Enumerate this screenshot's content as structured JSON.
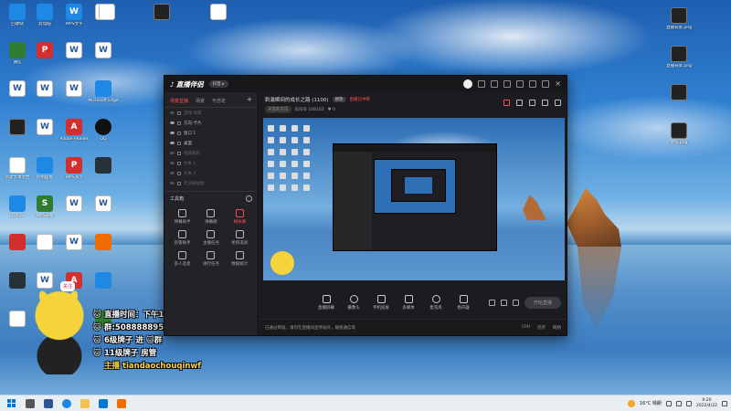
{
  "desktop": {
    "left_icons": [
      {
        "label": "回收站",
        "glyph": "",
        "cls": "g-blue"
      },
      {
        "label": "微信",
        "glyph": "",
        "cls": "g-green"
      },
      {
        "label": "",
        "glyph": "W",
        "cls": "g-doc"
      },
      {
        "label": "",
        "glyph": "",
        "cls": "g-img"
      },
      {
        "label": "新建文本文档",
        "glyph": "",
        "cls": "g-doc"
      },
      {
        "label": "10619",
        "glyph": "",
        "cls": "g-blue"
      },
      {
        "label": "",
        "glyph": "",
        "cls": "g-red"
      },
      {
        "label": "",
        "glyph": "",
        "cls": "g-dark"
      },
      {
        "label": "",
        "glyph": "",
        "cls": "g-doc"
      },
      {
        "label": "此电脑",
        "glyph": "",
        "cls": "g-blue"
      },
      {
        "label": "",
        "glyph": "P",
        "cls": "g-red"
      },
      {
        "label": "",
        "glyph": "W",
        "cls": "g-doc"
      },
      {
        "label": "",
        "glyph": "W",
        "cls": "g-doc"
      },
      {
        "label": "控制面板",
        "glyph": "",
        "cls": "g-blue"
      },
      {
        "label": "WPS表格",
        "glyph": "S",
        "cls": "g-green"
      },
      {
        "label": "",
        "glyph": "",
        "cls": "g-doc"
      },
      {
        "label": "",
        "glyph": "W",
        "cls": "g-doc"
      },
      {
        "label": "",
        "glyph": "",
        "cls": "g-dark"
      },
      {
        "label": "WPS文字",
        "glyph": "W",
        "cls": "g-blue"
      },
      {
        "label": "",
        "glyph": "W",
        "cls": "g-doc"
      },
      {
        "label": "",
        "glyph": "W",
        "cls": "g-doc"
      },
      {
        "label": "Adobe Reader",
        "glyph": "A",
        "cls": "g-red"
      },
      {
        "label": "WPS演示",
        "glyph": "P",
        "cls": "g-red"
      },
      {
        "label": "",
        "glyph": "W",
        "cls": "g-doc"
      },
      {
        "label": "",
        "glyph": "W",
        "cls": "g-doc"
      },
      {
        "label": "",
        "glyph": "A",
        "cls": "g-red"
      },
      {
        "label": "",
        "glyph": "",
        "cls": "g-orange"
      },
      {
        "label": "",
        "glyph": "W",
        "cls": "g-doc"
      },
      {
        "label": "",
        "glyph": "W",
        "cls": "g-doc"
      },
      {
        "label": "Microsoft Edge",
        "glyph": "",
        "cls": "g-blue"
      },
      {
        "label": "QQ",
        "glyph": "",
        "cls": "g-qq"
      },
      {
        "label": "",
        "glyph": "",
        "cls": "g-dark"
      },
      {
        "label": "",
        "glyph": "W",
        "cls": "g-doc"
      },
      {
        "label": "",
        "glyph": "",
        "cls": "g-orange"
      },
      {
        "label": "",
        "glyph": "",
        "cls": "g-blue"
      },
      {
        "label": "",
        "glyph": "",
        "cls": "g-green"
      }
    ],
    "right_icons": [
      {
        "label": "直播背景.png",
        "cls": "g-img"
      },
      {
        "label": "直播背景.png",
        "cls": "g-img"
      },
      {
        "label": "",
        "cls": "g-img"
      },
      {
        "label": "壁纸.png",
        "cls": "g-img"
      }
    ]
  },
  "overlay": {
    "bubble": "关注",
    "lines": [
      {
        "icon": "🐱",
        "text": "直播时间：下午1-6 晚上8-12"
      },
      {
        "icon": "🐱",
        "text": "群:508888895"
      },
      {
        "icon": "🐱",
        "text": "6级牌子 进 🐱群"
      },
      {
        "icon": "🐱",
        "text": "11级牌子 房管"
      },
      {
        "icon": "",
        "text": "主播 tiandaochouqinwf"
      }
    ]
  },
  "app": {
    "title": "直播伴侣",
    "version_badge": "抖音 ▸",
    "left_tabs": [
      "场景直播",
      "场景",
      "可自定"
    ],
    "layers": [
      {
        "name": "游戏 场景",
        "dim": true
      },
      {
        "name": "方向-卡片",
        "dim": false
      },
      {
        "name": "窗口 1",
        "dim": false
      },
      {
        "name": "桌面",
        "dim": false
      },
      {
        "name": "视频捕获",
        "dim": true
      },
      {
        "name": "文本 1",
        "dim": true
      },
      {
        "name": "文本 2",
        "dim": true
      },
      {
        "name": "无法播放图",
        "dim": true
      }
    ],
    "tools_label": "工具箱",
    "tools": [
      {
        "label": "弹幕助手",
        "hot": false
      },
      {
        "label": "弹幕姬",
        "hot": false
      },
      {
        "label": "媒体库",
        "hot": true
      },
      {
        "label": "房管助手",
        "hot": false
      },
      {
        "label": "主播任务",
        "hot": false
      },
      {
        "label": "抢购道具",
        "hot": false
      },
      {
        "label": "多人连麦",
        "hot": false
      },
      {
        "label": "进行任务",
        "hot": false
      },
      {
        "label": "数据统计",
        "hot": false
      }
    ],
    "room_title": "刺激瞬间的成长之路 (1100)",
    "room_pill": "修改",
    "room_red": "直播已中断",
    "room_category": "天堂的方向",
    "room_id": "房间号 108183",
    "room_like": "♥ 0",
    "controls": [
      {
        "label": "直播屏幕",
        "round": false
      },
      {
        "label": "摄像头",
        "round": true
      },
      {
        "label": "手机投屏",
        "round": false
      },
      {
        "label": "多媒体",
        "round": false
      },
      {
        "label": "麦克风",
        "round": true
      },
      {
        "label": "扬声器",
        "round": false
      }
    ],
    "start_button": "开始直播",
    "status_left": "已通过审核，请勿在直播间宣传站外，联络通信等",
    "status_right": [
      "CPU",
      "内存",
      "网络"
    ]
  },
  "taskbar": {
    "weather": "16°C 晴朗",
    "time": "9:20",
    "date": "2022/4/22"
  }
}
